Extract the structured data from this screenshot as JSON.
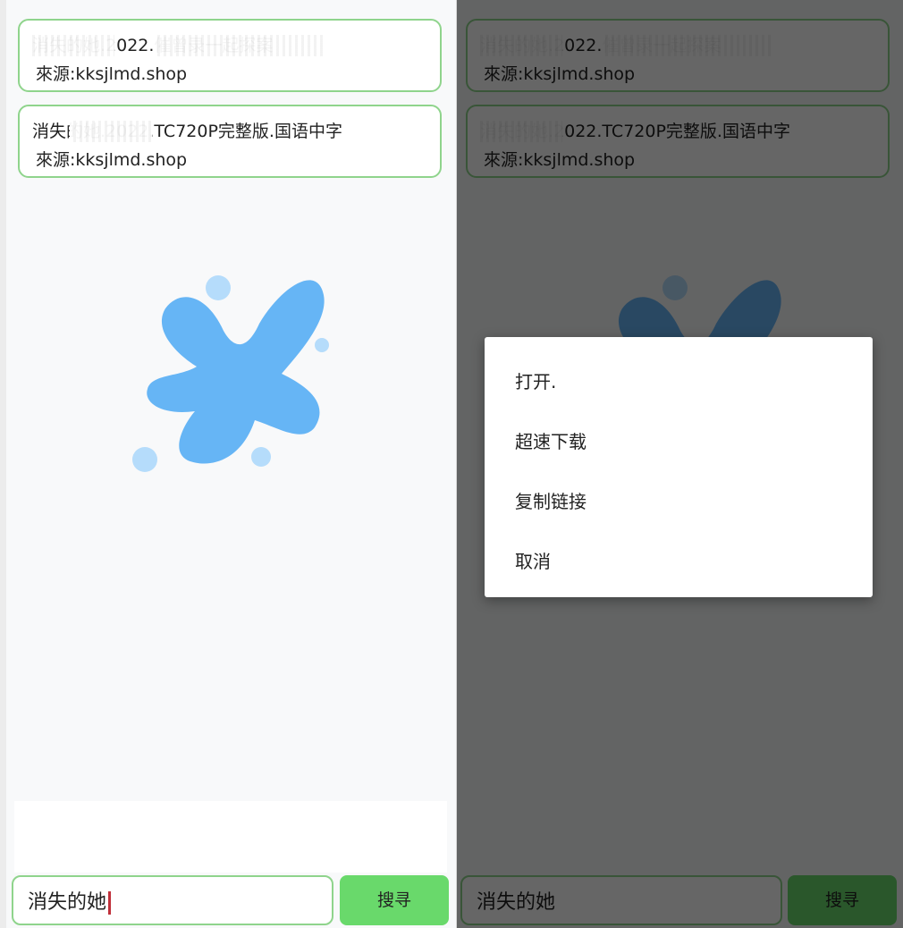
{
  "results": [
    {
      "title": "消失的她.2022.催曾录一起探案",
      "source": "來源:kksjlmd.shop"
    },
    {
      "title": "消失的她.2022.TC720P完整版.国语中字",
      "source": "來源:kksjlmd.shop"
    }
  ],
  "search": {
    "value": "消失的她",
    "button_label": "搜寻"
  },
  "context_menu": {
    "items": [
      "打开.",
      "超速下载",
      "复制链接",
      "取消"
    ]
  },
  "colors": {
    "accent_green": "#69d96b",
    "border_green": "#8fd48c",
    "logo_blue": "#66b5f5"
  }
}
